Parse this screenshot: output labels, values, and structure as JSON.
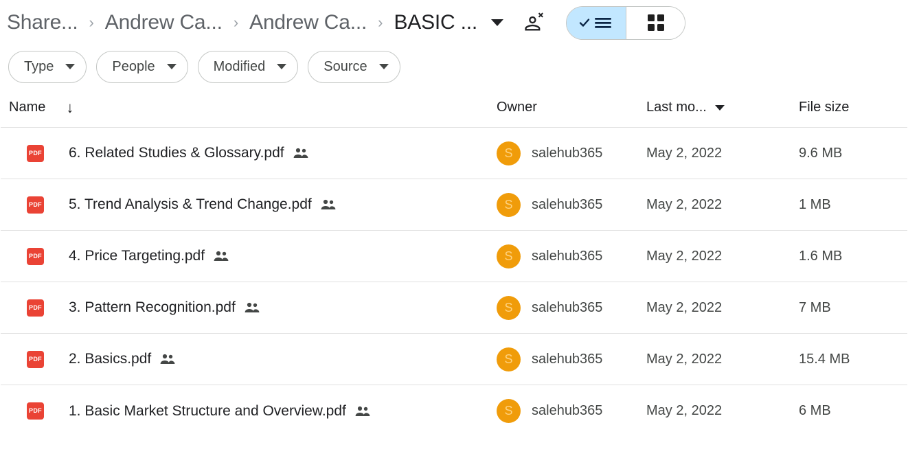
{
  "breadcrumb": {
    "items": [
      {
        "label": "Share...",
        "current": false
      },
      {
        "label": "Andrew Ca...",
        "current": false
      },
      {
        "label": "Andrew Ca...",
        "current": false
      },
      {
        "label": "BASIC ...",
        "current": true
      }
    ],
    "separator": "›",
    "dropdown_icon": "chevron-down-icon",
    "share_icon": "person-add-icon"
  },
  "view_toggle": {
    "list_label": "list-view",
    "grid_label": "grid-view",
    "active": "list",
    "active_bg": "#c2e7ff"
  },
  "filters": [
    {
      "label": "Type"
    },
    {
      "label": "People"
    },
    {
      "label": "Modified"
    },
    {
      "label": "Source"
    }
  ],
  "table": {
    "columns": {
      "name": "Name",
      "owner": "Owner",
      "modified": "Last mo...",
      "size": "File size"
    },
    "sort": {
      "column": "Name",
      "direction": "descending",
      "icon": "arrow-down-icon"
    },
    "rows": [
      {
        "icon": "pdf-icon",
        "icon_label": "PDF",
        "name": "6. Related Studies & Glossary.pdf",
        "shared": true,
        "owner_initial": "S",
        "owner": "salehub365",
        "modified": "May 2, 2022",
        "size": "9.6 MB"
      },
      {
        "icon": "pdf-icon",
        "icon_label": "PDF",
        "name": "5. Trend Analysis & Trend Change.pdf",
        "shared": true,
        "owner_initial": "S",
        "owner": "salehub365",
        "modified": "May 2, 2022",
        "size": "1 MB"
      },
      {
        "icon": "pdf-icon",
        "icon_label": "PDF",
        "name": "4. Price Targeting.pdf",
        "shared": true,
        "owner_initial": "S",
        "owner": "salehub365",
        "modified": "May 2, 2022",
        "size": "1.6 MB"
      },
      {
        "icon": "pdf-icon",
        "icon_label": "PDF",
        "name": "3. Pattern Recognition.pdf",
        "shared": true,
        "owner_initial": "S",
        "owner": "salehub365",
        "modified": "May 2, 2022",
        "size": "7 MB"
      },
      {
        "icon": "pdf-icon",
        "icon_label": "PDF",
        "name": "2. Basics.pdf",
        "shared": true,
        "owner_initial": "S",
        "owner": "salehub365",
        "modified": "May 2, 2022",
        "size": "15.4 MB"
      },
      {
        "icon": "pdf-icon",
        "icon_label": "PDF",
        "name": "1. Basic Market Structure and Overview.pdf",
        "shared": true,
        "owner_initial": "S",
        "owner": "salehub365",
        "modified": "May 2, 2022",
        "size": "6 MB"
      }
    ]
  },
  "colors": {
    "pdf_red": "#EA4335",
    "avatar_orange": "#F09C0A",
    "toggle_active": "#c2e7ff",
    "text_primary": "#202124",
    "text_secondary": "#444746",
    "crumb_gray": "#5f6368",
    "divider": "#e0e0e0"
  }
}
